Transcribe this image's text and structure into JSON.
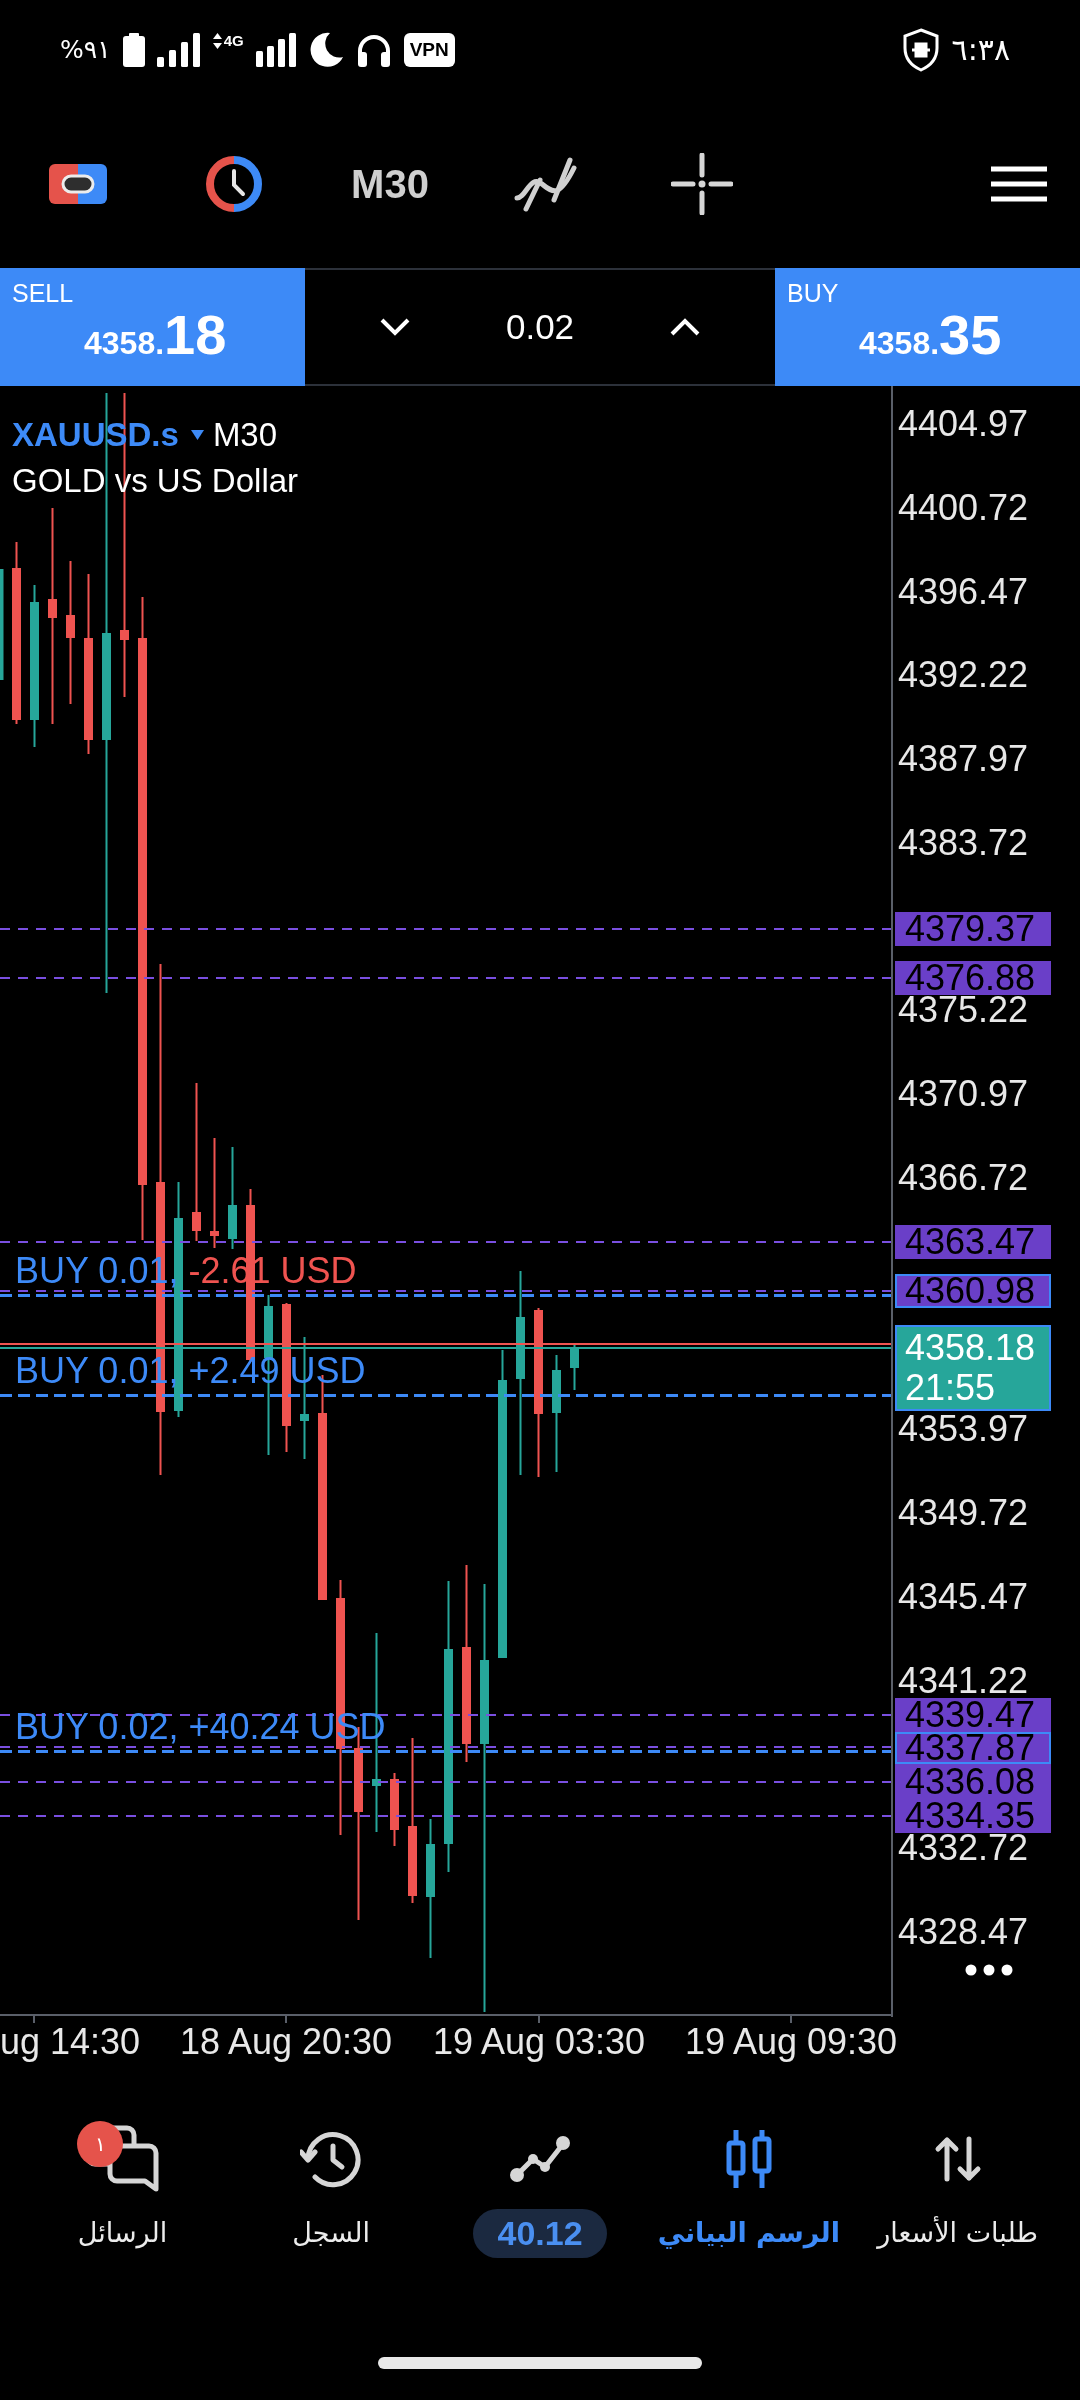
{
  "status_bar": {
    "battery": "%٩١",
    "network": "4G",
    "vpn": "VPN",
    "time": "٦:٣٨"
  },
  "toolbar": {
    "timeframe": "M30"
  },
  "trade_bar": {
    "sell": {
      "label": "SELL",
      "price": "4358.",
      "price_big": "18"
    },
    "volume": "0.02",
    "buy": {
      "label": "BUY",
      "price": "4358.",
      "price_big": "35"
    }
  },
  "chart": {
    "symbol": "XAUUSD.s",
    "timeframe": "M30",
    "description": "GOLD vs US Dollar",
    "price_axis": [
      "4404.97",
      "4400.72",
      "4396.47",
      "4392.22",
      "4387.97",
      "4383.72",
      "4375.22",
      "4370.97",
      "4366.72",
      "4353.97",
      "4349.72",
      "4345.47",
      "4341.22",
      "4332.72",
      "4328.47"
    ],
    "price_tags": [
      {
        "kind": "level",
        "price": "4379.37",
        "position": false
      },
      {
        "kind": "level",
        "price": "4376.88",
        "position": false
      },
      {
        "kind": "level",
        "price": "4363.47",
        "position": false
      },
      {
        "kind": "level",
        "price": "4360.98",
        "position": true
      },
      {
        "kind": "current",
        "price": "4358.18",
        "time": "21:55",
        "position": true
      },
      {
        "kind": "level",
        "price": "4339.47",
        "position": false
      },
      {
        "kind": "level",
        "price": "4337.87",
        "position": true
      },
      {
        "kind": "level",
        "price": "4336.08",
        "position": false
      },
      {
        "kind": "level",
        "price": "4334.35",
        "position": false
      }
    ],
    "trades": [
      {
        "label": "BUY 0.01,",
        "profit": "-2.61 USD",
        "negative": true
      },
      {
        "label": "BUY 0.01,",
        "profit": "+2.49 USD",
        "negative": false
      },
      {
        "label": "BUY 0.02,",
        "profit": "+40.24 USD",
        "negative": false
      }
    ],
    "time_axis": [
      "ug 14:30",
      "18 Aug 20:30",
      "19 Aug 03:30",
      "19 Aug 09:30"
    ]
  },
  "bottom_nav": [
    {
      "kind": "quotes",
      "label": "طلبات الأسعار",
      "selected": false
    },
    {
      "kind": "chart",
      "label": "الرسم البياني",
      "selected": true
    },
    {
      "kind": "trade",
      "value": "40.12",
      "selected": false
    },
    {
      "kind": "history",
      "label": "السجل",
      "selected": false
    },
    {
      "kind": "messages",
      "label": "الرسائل",
      "badge": "١",
      "selected": false
    }
  ]
}
